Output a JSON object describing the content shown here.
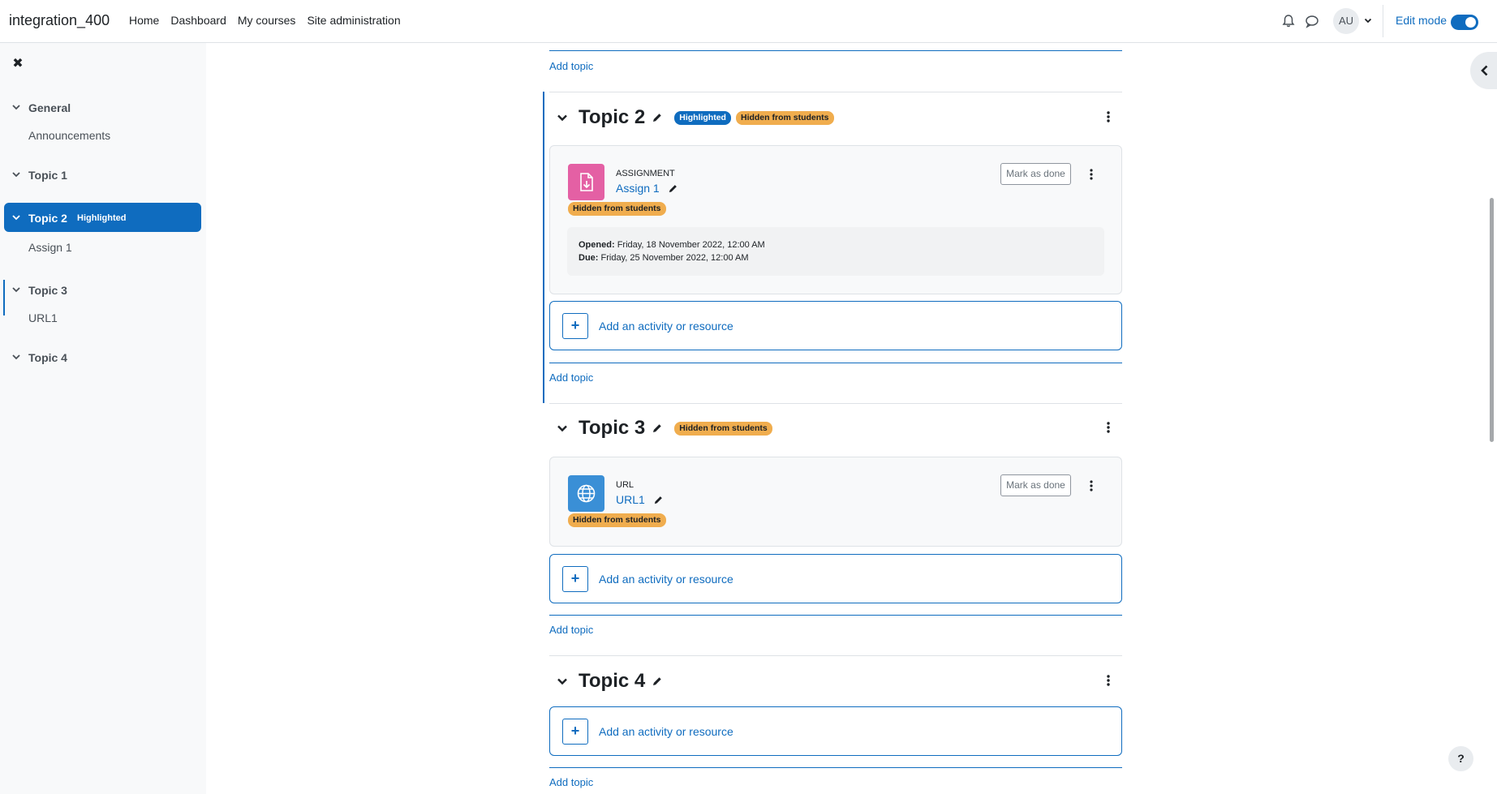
{
  "navbar": {
    "brand": "integration_400",
    "links": [
      "Home",
      "Dashboard",
      "My courses",
      "Site administration"
    ],
    "avatar_initials": "AU",
    "edit_mode_label": "Edit mode",
    "edit_mode_on": true
  },
  "course_index": {
    "sections": [
      {
        "label": "General",
        "items": [
          "Announcements"
        ]
      },
      {
        "label": "Topic 1",
        "items": []
      },
      {
        "label": "Topic 2",
        "badge": "Highlighted",
        "items": [
          "Assign 1"
        ]
      },
      {
        "label": "Topic 3",
        "items": [
          "URL1"
        ]
      },
      {
        "label": "Topic 4",
        "items": []
      }
    ]
  },
  "main": {
    "add_topic_label": "Add topic",
    "add_activity_label": "Add an activity or resource",
    "topics": [
      {
        "title": "Topic 2",
        "badges": [
          "Highlighted",
          "Hidden from students"
        ],
        "activity": {
          "type": "ASSIGNMENT",
          "name": "Assign 1",
          "badge": "Hidden from students",
          "mark_done": "Mark as done",
          "opened_label": "Opened:",
          "opened_value": "Friday, 18 November 2022, 12:00 AM",
          "due_label": "Due:",
          "due_value": "Friday, 25 November 2022, 12:00 AM"
        }
      },
      {
        "title": "Topic 3",
        "badges": [
          "Hidden from students"
        ],
        "activity": {
          "type": "URL",
          "name": "URL1",
          "badge": "Hidden from students",
          "mark_done": "Mark as done"
        }
      },
      {
        "title": "Topic 4",
        "badges": []
      }
    ]
  },
  "help_label": "?",
  "colors": {
    "primary": "#0f6cbf",
    "assignment_icon": "#e460a4",
    "url_icon": "#3a8fd6",
    "badge_warning": "#f0ad4e"
  }
}
